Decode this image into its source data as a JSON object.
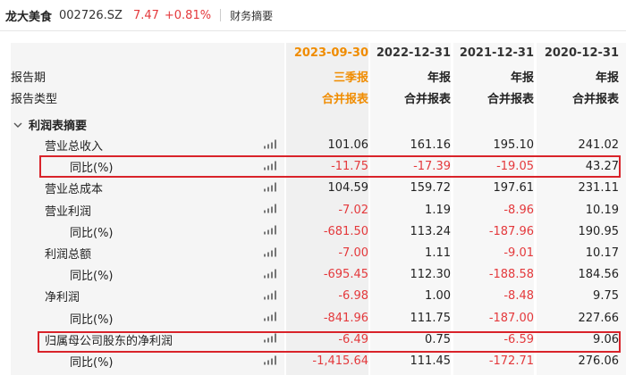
{
  "header": {
    "name": "龙大美食",
    "code": "002726.SZ",
    "price": "7.47",
    "change": "+0.81%",
    "section": "财务摘要"
  },
  "columns": [
    "2023-09-30",
    "2022-12-31",
    "2021-12-31",
    "2020-12-31"
  ],
  "period_label": "报告期",
  "type_label": "报告类型",
  "periods": [
    "三季报",
    "年报",
    "年报",
    "年报"
  ],
  "types": [
    "合并报表",
    "合并报表",
    "合并报表",
    "合并报表"
  ],
  "section_title": "利润表摘要",
  "rows": [
    {
      "label": "营业总收入",
      "values": [
        "101.06",
        "161.16",
        "195.10",
        "241.02"
      ]
    },
    {
      "label": "同比(%)",
      "values": [
        "-11.75",
        "-17.39",
        "-19.05",
        "43.27"
      ]
    },
    {
      "label": "营业总成本",
      "values": [
        "104.59",
        "159.72",
        "197.61",
        "231.11"
      ]
    },
    {
      "label": "营业利润",
      "values": [
        "-7.02",
        "1.19",
        "-8.96",
        "10.19"
      ]
    },
    {
      "label": "同比(%)",
      "values": [
        "-681.50",
        "113.24",
        "-187.96",
        "190.95"
      ]
    },
    {
      "label": "利润总额",
      "values": [
        "-7.00",
        "1.11",
        "-9.01",
        "10.17"
      ]
    },
    {
      "label": "同比(%)",
      "values": [
        "-695.45",
        "112.30",
        "-188.58",
        "184.56"
      ]
    },
    {
      "label": "净利润",
      "values": [
        "-6.98",
        "1.00",
        "-8.48",
        "9.75"
      ]
    },
    {
      "label": "同比(%)",
      "values": [
        "-841.96",
        "111.75",
        "-187.00",
        "227.66"
      ]
    },
    {
      "label": "归属母公司股东的净利润",
      "values": [
        "-6.49",
        "0.75",
        "-6.59",
        "9.06"
      ]
    },
    {
      "label": "同比(%)",
      "values": [
        "-1,415.64",
        "111.45",
        "-172.71",
        "276.06"
      ]
    }
  ],
  "colors": {
    "negative": "#e4393c",
    "accent": "#f08c00",
    "highlight": "#d9232a"
  }
}
